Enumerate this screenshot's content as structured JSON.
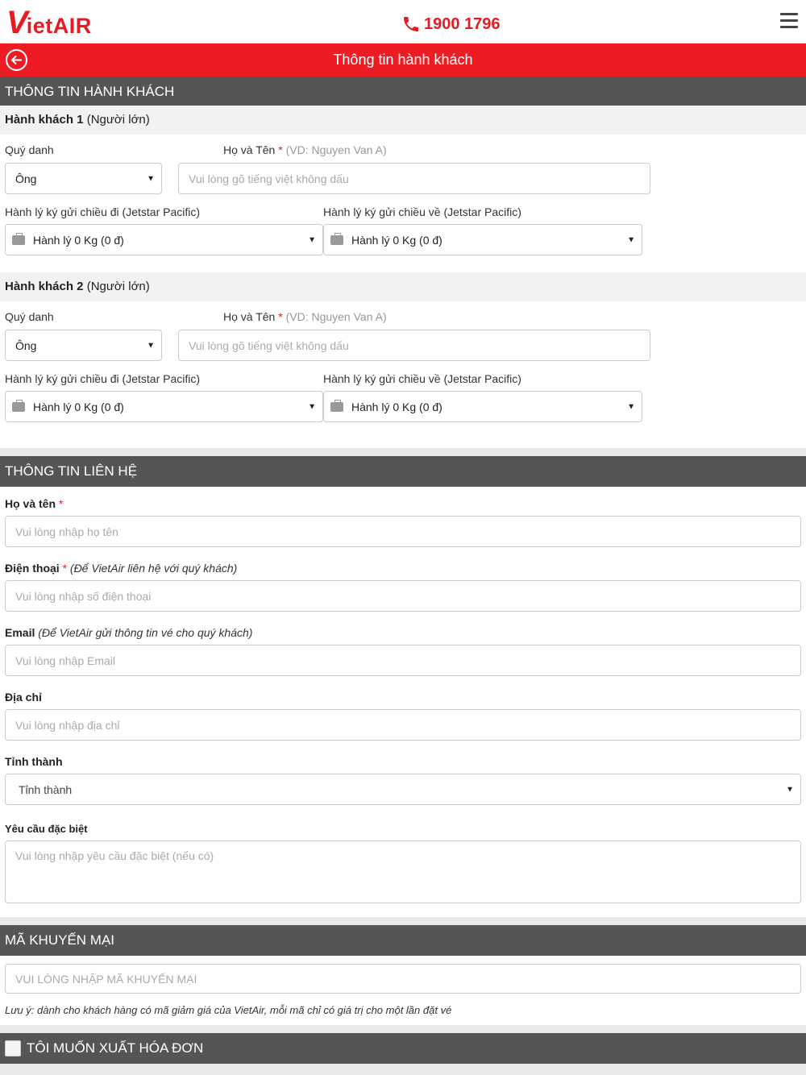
{
  "header": {
    "logo_v": "V",
    "logo_text": "ietAIR",
    "hotline": "1900 1796"
  },
  "titlebar": {
    "title": "Thông tin hành khách"
  },
  "passenger_section": {
    "title": "THÔNG TIN HÀNH KHÁCH"
  },
  "passengers": [
    {
      "heading": "Hành khách 1",
      "type": "(Người lớn)",
      "title_label": "Quý danh",
      "title_value": "Ông",
      "name_label": "Họ và Tên",
      "name_hint": "(VD: Nguyen Van A)",
      "name_placeholder": "Vui lòng gõ tiếng việt không dấu",
      "bag_out_label": "Hành lý ký gửi chiều đi (Jetstar Pacific)",
      "bag_out_value": "Hành lý 0 Kg (0 đ)",
      "bag_ret_label": "Hành lý ký gửi chiều về (Jetstar Pacific)",
      "bag_ret_value": "Hành lý 0 Kg (0 đ)"
    },
    {
      "heading": "Hành khách 2",
      "type": "(Người lớn)",
      "title_label": "Quý danh",
      "title_value": "Ông",
      "name_label": "Họ và Tên",
      "name_hint": "(VD: Nguyen Van A)",
      "name_placeholder": "Vui lòng gõ tiếng việt không dấu",
      "bag_out_label": "Hành lý ký gửi chiều đi (Jetstar Pacific)",
      "bag_out_value": "Hành lý 0 Kg (0 đ)",
      "bag_ret_label": "Hành lý ký gửi chiều về (Jetstar Pacific)",
      "bag_ret_value": "Hành lý 0 Kg (0 đ)"
    }
  ],
  "contact": {
    "title": "THÔNG TIN LIÊN HỆ",
    "name_label": "Họ và tên",
    "name_placeholder": "Vui lòng nhập họ tên",
    "phone_label": "Điện thoại",
    "phone_hint": "(Để VietAir liên hệ với quý khách)",
    "phone_placeholder": "Vui lòng nhập số điện thoại",
    "email_label": "Email",
    "email_hint": "(Để VietAir gửi thông tin vé cho quý khách)",
    "email_placeholder": "Vui lòng nhập Email",
    "address_label": "Địa chỉ",
    "address_placeholder": "Vui lòng nhập địa chỉ",
    "province_label": "Tỉnh thành",
    "province_value": "Tỉnh thành",
    "special_label": "Yêu cầu đặc biệt",
    "special_placeholder": "Vui lòng nhập yêu cầu đặc biệt (nếu có)"
  },
  "promo": {
    "title": "MÃ KHUYẾN MẠI",
    "placeholder": "VUI LÒNG NHẬP MÃ KHUYẾN MẠI",
    "note": "Lưu ý: dành cho khách hàng có mã giảm giá của VietAir, mỗi mã chỉ có giá trị cho một lần đặt vé"
  },
  "invoice": {
    "label": "TÔI MUỐN XUẤT HÓA ĐƠN",
    "checked": false
  },
  "colors": {
    "brand_red": "#ed1c24",
    "section_gray": "#555555"
  },
  "icons": [
    "phone-icon",
    "menu-icon",
    "back-arrow-icon",
    "luggage-icon",
    "caret-down-icon",
    "checkbox-icon"
  ]
}
